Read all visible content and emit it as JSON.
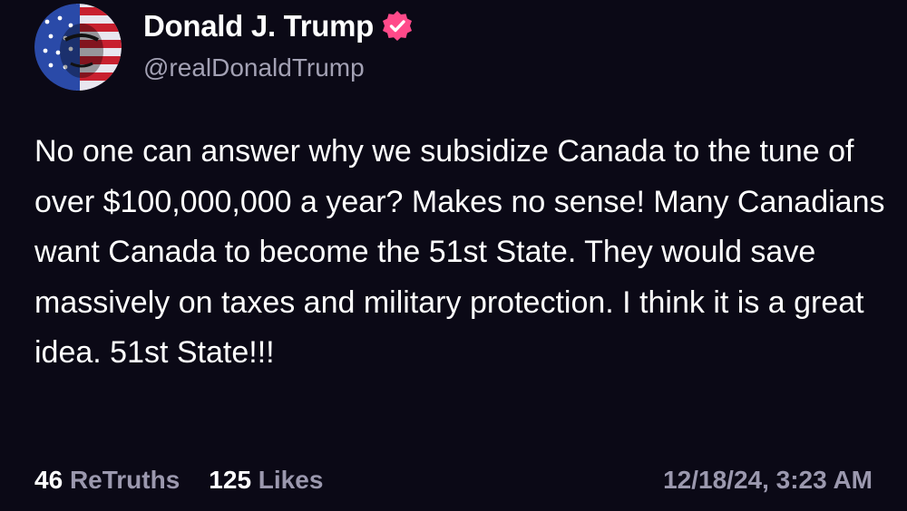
{
  "author": {
    "name": "Donald J. Trump",
    "handle": "@realDonaldTrump",
    "verified": true,
    "avatar_icon": "flag-portrait-avatar",
    "verified_color": "#ff4a8a"
  },
  "post": {
    "text": "No one can answer why we subsidize Canada to the tune of over $100,000,000 a year? Makes no sense! Many Canadians want Canada to become the 51st State. They would save massively on taxes and military protection. I think it is a great idea. 51st State!!!"
  },
  "stats": {
    "retruths_count": "46",
    "retruths_label": "ReTruths",
    "likes_count": "125",
    "likes_label": "Likes"
  },
  "timestamp": "12/18/24, 3:23 AM",
  "colors": {
    "background": "#0b0916",
    "text": "#ffffff",
    "muted": "#9b98ae"
  }
}
